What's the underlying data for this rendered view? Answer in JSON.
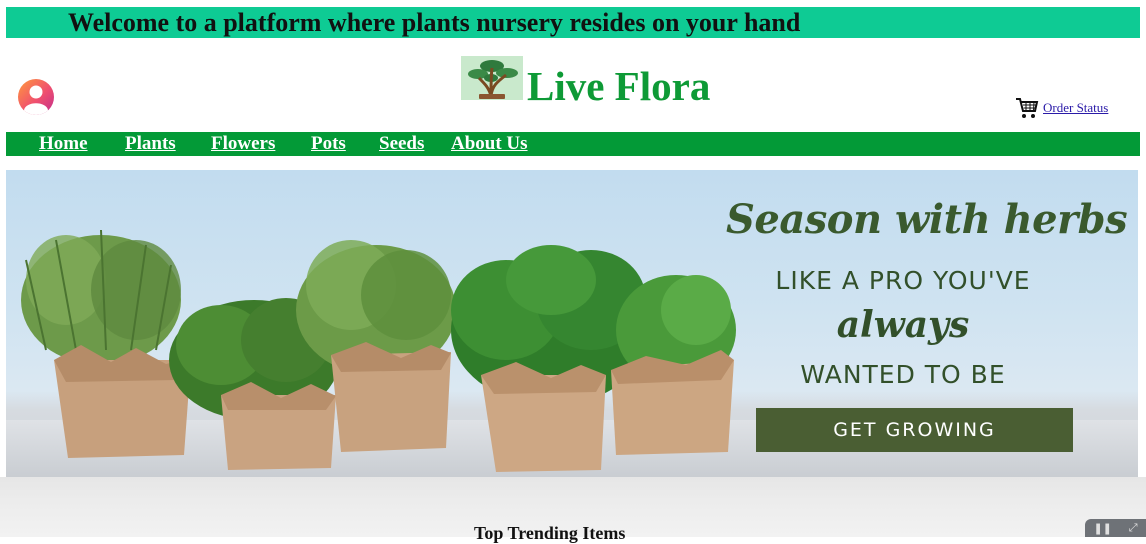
{
  "welcome": {
    "text": "Welcome to a platform where plants nursery resides on your hand"
  },
  "header": {
    "brand": "Live Flora",
    "logo_icon": "bonsai-tree-icon",
    "avatar_icon": "user-avatar-icon",
    "order_status": {
      "icon": "shopping-cart-icon",
      "label": "Order Status"
    }
  },
  "nav": {
    "items": [
      {
        "label": "Home"
      },
      {
        "label": "Plants"
      },
      {
        "label": "Flowers"
      },
      {
        "label": "Pots"
      },
      {
        "label": "Seeds"
      },
      {
        "label": "About Us"
      }
    ]
  },
  "hero": {
    "headline": "Season with herbs",
    "line1": "LIKE A PRO YOU'VE",
    "script": "always",
    "line2": "WANTED TO BE",
    "cta": "GET GROWING"
  },
  "section": {
    "title": "Top Trending Items"
  },
  "player": {
    "pause_icon": "pause-icon",
    "fullscreen_icon": "fullscreen-icon"
  },
  "colors": {
    "welcome_bg": "#0ecb94",
    "nav_bg": "#039a37",
    "brand": "#0e9a36",
    "hero_text": "#32502a",
    "cta_bg": "#4a5e33"
  }
}
